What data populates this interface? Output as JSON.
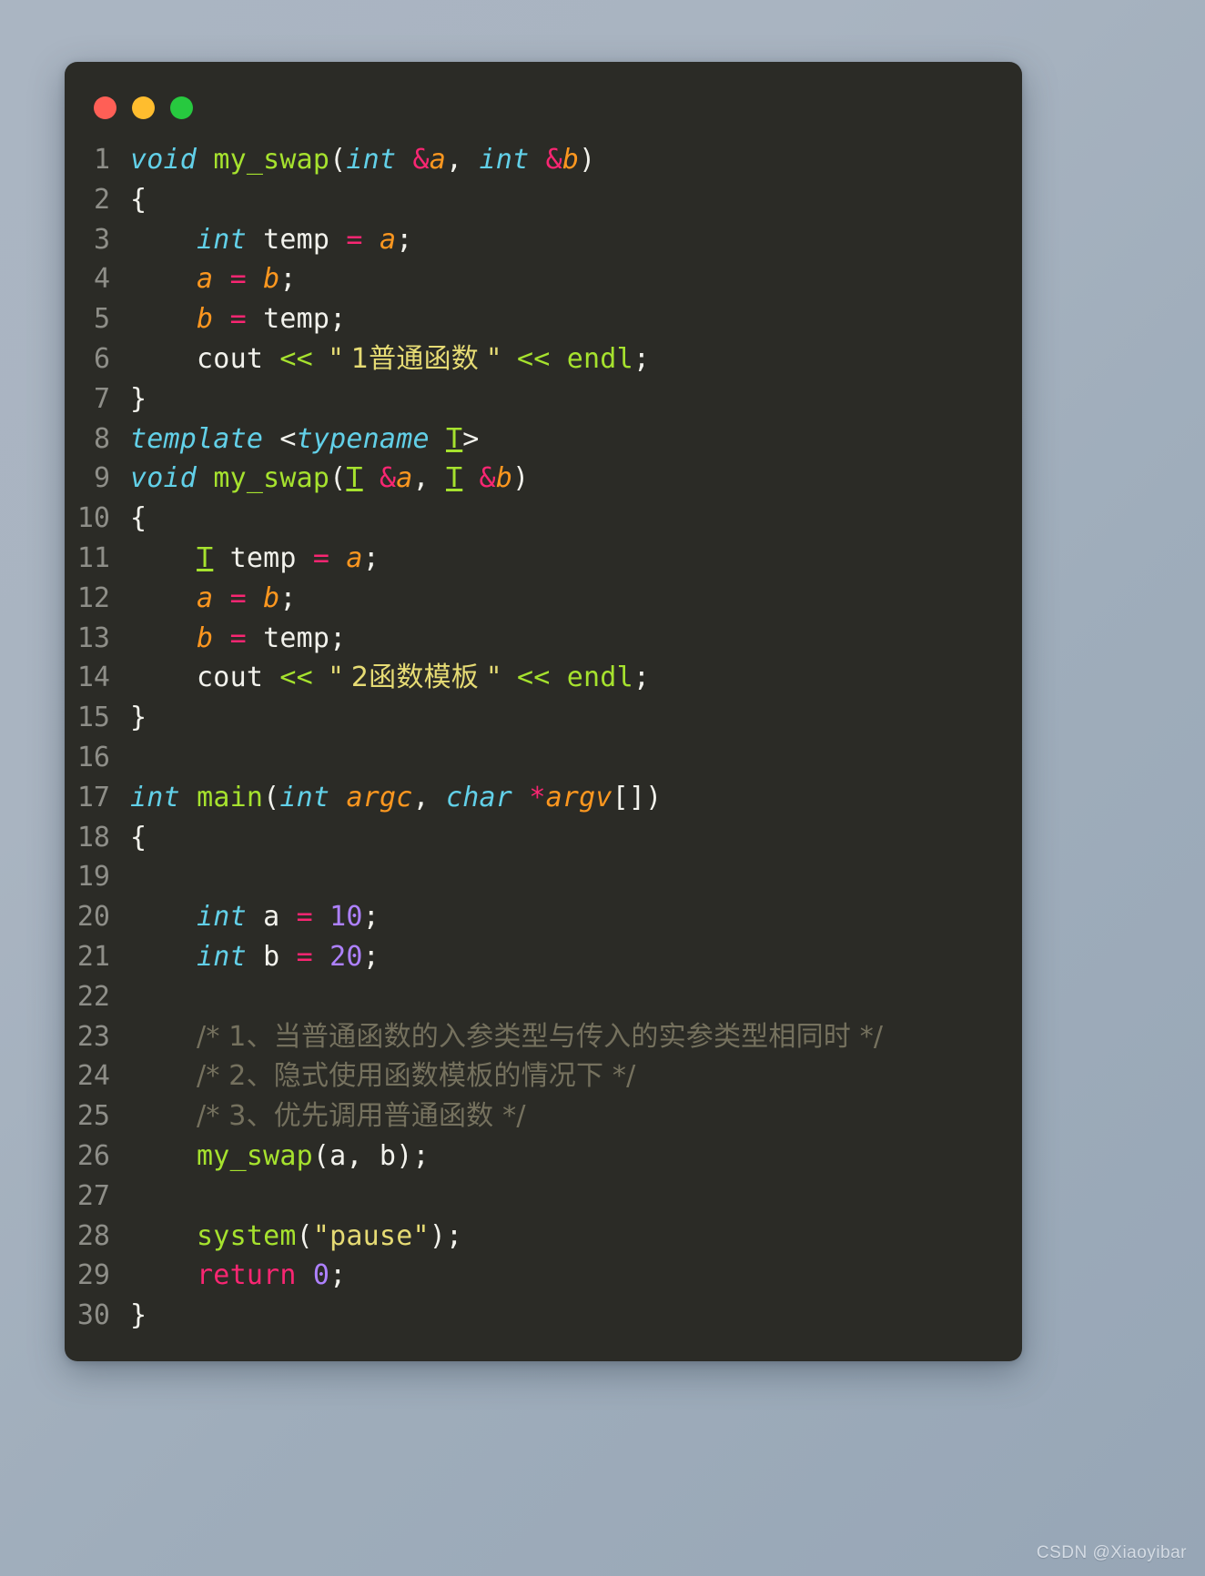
{
  "window": {
    "title_bar": {
      "buttons": [
        {
          "name": "close",
          "color": "#ff5f56"
        },
        {
          "name": "minimize",
          "color": "#ffbd2e"
        },
        {
          "name": "maximize",
          "color": "#27c93f"
        }
      ]
    },
    "background_color": "#2b2b26"
  },
  "theme": {
    "page_background_start": "#aab5c2",
    "page_background_end": "#97a6b6",
    "keyword": "#62d0e8",
    "function": "#a6e22e",
    "operator": "#f92672",
    "variable": "#fd971f",
    "string": "#e6db74",
    "number": "#ae81ff",
    "comment": "#75715e",
    "plain": "#f2f2ec",
    "line_number": "#8e8e88"
  },
  "watermark": "CSDN @Xiaoyibar",
  "code": {
    "language": "cpp",
    "first_line": 1,
    "last_line": 30,
    "line_numbers": [
      "1",
      "2",
      "3",
      "4",
      "5",
      "6",
      "7",
      "8",
      "9",
      "10",
      "11",
      "12",
      "13",
      "14",
      "15",
      "16",
      "17",
      "18",
      "19",
      "20",
      "21",
      "22",
      "23",
      "24",
      "25",
      "26",
      "27",
      "28",
      "29",
      "30"
    ],
    "lines": [
      "void my_swap(int &a, int &b)",
      "{",
      "    int temp = a;",
      "    a = b;",
      "    b = temp;",
      "    cout << \" 1普通函数 \" << endl;",
      "}",
      "template <typename T>",
      "void my_swap(T &a, T &b)",
      "{",
      "    T temp = a;",
      "    a = b;",
      "    b = temp;",
      "    cout << \" 2函数模板 \" << endl;",
      "}",
      "",
      "int main(int argc, char *argv[])",
      "{",
      "",
      "    int a = 10;",
      "    int b = 20;",
      "",
      "    /* 1、当普通函数的入参类型与传入的实参类型相同时 */",
      "    /* 2、隐式使用函数模板的情况下 */",
      "    /* 3、优先调用普通函数 */",
      "    my_swap(a, b);",
      "",
      "    system(\"pause\");",
      "    return 0;",
      "}"
    ],
    "tokens": [
      [
        {
          "t": "void",
          "c": "kw"
        },
        {
          "t": " ",
          "c": "plain"
        },
        {
          "t": "my_swap",
          "c": "fn"
        },
        {
          "t": "(",
          "c": "plain"
        },
        {
          "t": "int",
          "c": "kw"
        },
        {
          "t": " ",
          "c": "plain"
        },
        {
          "t": "&",
          "c": "op"
        },
        {
          "t": "a",
          "c": "var"
        },
        {
          "t": ", ",
          "c": "plain"
        },
        {
          "t": "int",
          "c": "kw"
        },
        {
          "t": " ",
          "c": "plain"
        },
        {
          "t": "&",
          "c": "op"
        },
        {
          "t": "b",
          "c": "var"
        },
        {
          "t": ")",
          "c": "plain"
        }
      ],
      [
        {
          "t": "{",
          "c": "plain"
        }
      ],
      [
        {
          "t": "    ",
          "c": "plain"
        },
        {
          "t": "int",
          "c": "kw"
        },
        {
          "t": " temp ",
          "c": "plain"
        },
        {
          "t": "=",
          "c": "op"
        },
        {
          "t": " ",
          "c": "plain"
        },
        {
          "t": "a",
          "c": "var"
        },
        {
          "t": ";",
          "c": "plain"
        }
      ],
      [
        {
          "t": "    ",
          "c": "plain"
        },
        {
          "t": "a",
          "c": "var"
        },
        {
          "t": " ",
          "c": "plain"
        },
        {
          "t": "=",
          "c": "op"
        },
        {
          "t": " ",
          "c": "plain"
        },
        {
          "t": "b",
          "c": "var"
        },
        {
          "t": ";",
          "c": "plain"
        }
      ],
      [
        {
          "t": "    ",
          "c": "plain"
        },
        {
          "t": "b",
          "c": "var"
        },
        {
          "t": " ",
          "c": "plain"
        },
        {
          "t": "=",
          "c": "op"
        },
        {
          "t": " temp;",
          "c": "plain"
        }
      ],
      [
        {
          "t": "    cout ",
          "c": "plain"
        },
        {
          "t": "<<",
          "c": "fn"
        },
        {
          "t": " ",
          "c": "plain"
        },
        {
          "t": "\" 1普通函数 \"",
          "c": "str"
        },
        {
          "t": " ",
          "c": "plain"
        },
        {
          "t": "<<",
          "c": "fn"
        },
        {
          "t": " ",
          "c": "plain"
        },
        {
          "t": "endl",
          "c": "fn"
        },
        {
          "t": ";",
          "c": "plain"
        }
      ],
      [
        {
          "t": "}",
          "c": "plain"
        }
      ],
      [
        {
          "t": "template",
          "c": "kw"
        },
        {
          "t": " <",
          "c": "plain"
        },
        {
          "t": "typename",
          "c": "kw"
        },
        {
          "t": " ",
          "c": "plain"
        },
        {
          "t": "T",
          "c": "type"
        },
        {
          "t": ">",
          "c": "plain"
        }
      ],
      [
        {
          "t": "void",
          "c": "kw"
        },
        {
          "t": " ",
          "c": "plain"
        },
        {
          "t": "my_swap",
          "c": "fn"
        },
        {
          "t": "(",
          "c": "plain"
        },
        {
          "t": "T",
          "c": "type"
        },
        {
          "t": " ",
          "c": "plain"
        },
        {
          "t": "&",
          "c": "op"
        },
        {
          "t": "a",
          "c": "var"
        },
        {
          "t": ", ",
          "c": "plain"
        },
        {
          "t": "T",
          "c": "type"
        },
        {
          "t": " ",
          "c": "plain"
        },
        {
          "t": "&",
          "c": "op"
        },
        {
          "t": "b",
          "c": "var"
        },
        {
          "t": ")",
          "c": "plain"
        }
      ],
      [
        {
          "t": "{",
          "c": "plain"
        }
      ],
      [
        {
          "t": "    ",
          "c": "plain"
        },
        {
          "t": "T",
          "c": "type"
        },
        {
          "t": " temp ",
          "c": "plain"
        },
        {
          "t": "=",
          "c": "op"
        },
        {
          "t": " ",
          "c": "plain"
        },
        {
          "t": "a",
          "c": "var"
        },
        {
          "t": ";",
          "c": "plain"
        }
      ],
      [
        {
          "t": "    ",
          "c": "plain"
        },
        {
          "t": "a",
          "c": "var"
        },
        {
          "t": " ",
          "c": "plain"
        },
        {
          "t": "=",
          "c": "op"
        },
        {
          "t": " ",
          "c": "plain"
        },
        {
          "t": "b",
          "c": "var"
        },
        {
          "t": ";",
          "c": "plain"
        }
      ],
      [
        {
          "t": "    ",
          "c": "plain"
        },
        {
          "t": "b",
          "c": "var"
        },
        {
          "t": " ",
          "c": "plain"
        },
        {
          "t": "=",
          "c": "op"
        },
        {
          "t": " temp;",
          "c": "plain"
        }
      ],
      [
        {
          "t": "    cout ",
          "c": "plain"
        },
        {
          "t": "<<",
          "c": "fn"
        },
        {
          "t": " ",
          "c": "plain"
        },
        {
          "t": "\" 2函数模板 \"",
          "c": "str"
        },
        {
          "t": " ",
          "c": "plain"
        },
        {
          "t": "<<",
          "c": "fn"
        },
        {
          "t": " ",
          "c": "plain"
        },
        {
          "t": "endl",
          "c": "fn"
        },
        {
          "t": ";",
          "c": "plain"
        }
      ],
      [
        {
          "t": "}",
          "c": "plain"
        }
      ],
      [],
      [
        {
          "t": "int",
          "c": "kw"
        },
        {
          "t": " ",
          "c": "plain"
        },
        {
          "t": "main",
          "c": "fn"
        },
        {
          "t": "(",
          "c": "plain"
        },
        {
          "t": "int",
          "c": "kw"
        },
        {
          "t": " ",
          "c": "plain"
        },
        {
          "t": "argc",
          "c": "var"
        },
        {
          "t": ", ",
          "c": "plain"
        },
        {
          "t": "char",
          "c": "kw"
        },
        {
          "t": " ",
          "c": "plain"
        },
        {
          "t": "*",
          "c": "op"
        },
        {
          "t": "argv",
          "c": "var"
        },
        {
          "t": "[])",
          "c": "plain"
        }
      ],
      [
        {
          "t": "{",
          "c": "plain"
        }
      ],
      [],
      [
        {
          "t": "    ",
          "c": "plain"
        },
        {
          "t": "int",
          "c": "kw"
        },
        {
          "t": " a ",
          "c": "plain"
        },
        {
          "t": "=",
          "c": "op"
        },
        {
          "t": " ",
          "c": "plain"
        },
        {
          "t": "10",
          "c": "num"
        },
        {
          "t": ";",
          "c": "plain"
        }
      ],
      [
        {
          "t": "    ",
          "c": "plain"
        },
        {
          "t": "int",
          "c": "kw"
        },
        {
          "t": " b ",
          "c": "plain"
        },
        {
          "t": "=",
          "c": "op"
        },
        {
          "t": " ",
          "c": "plain"
        },
        {
          "t": "20",
          "c": "num"
        },
        {
          "t": ";",
          "c": "plain"
        }
      ],
      [],
      [
        {
          "t": "    ",
          "c": "plain"
        },
        {
          "t": "/* 1、当普通函数的入参类型与传入的实参类型相同时 */",
          "c": "cmt"
        }
      ],
      [
        {
          "t": "    ",
          "c": "plain"
        },
        {
          "t": "/* 2、隐式使用函数模板的情况下 */",
          "c": "cmt"
        }
      ],
      [
        {
          "t": "    ",
          "c": "plain"
        },
        {
          "t": "/* 3、优先调用普通函数 */",
          "c": "cmt"
        }
      ],
      [
        {
          "t": "    ",
          "c": "plain"
        },
        {
          "t": "my_swap",
          "c": "fn"
        },
        {
          "t": "(a, b);",
          "c": "plain"
        }
      ],
      [],
      [
        {
          "t": "    ",
          "c": "plain"
        },
        {
          "t": "system",
          "c": "fn"
        },
        {
          "t": "(",
          "c": "plain"
        },
        {
          "t": "\"pause\"",
          "c": "str"
        },
        {
          "t": ");",
          "c": "plain"
        }
      ],
      [
        {
          "t": "    ",
          "c": "plain"
        },
        {
          "t": "return",
          "c": "ret"
        },
        {
          "t": " ",
          "c": "plain"
        },
        {
          "t": "0",
          "c": "num"
        },
        {
          "t": ";",
          "c": "plain"
        }
      ],
      [
        {
          "t": "}",
          "c": "plain"
        }
      ]
    ]
  }
}
